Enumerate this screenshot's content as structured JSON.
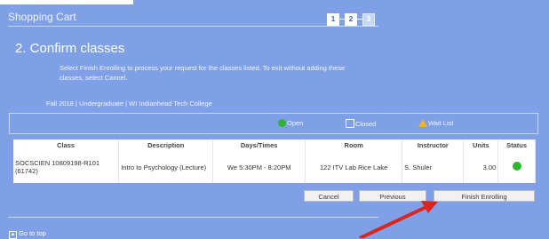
{
  "header": {
    "cart_title": "Shopping Cart",
    "steps": [
      "1",
      "2",
      "3"
    ],
    "active_steps": [
      1,
      2
    ]
  },
  "section": {
    "title": "2.  Confirm classes",
    "instructions": "Select Finish Enrolling to process your request for the classes listed. To exit without adding these classes, select Cancel.",
    "term": "Fall 2018 | Undergraduate | WI Indianhead Tech College"
  },
  "legend": {
    "open": "Open",
    "closed": "Closed",
    "wait_list": "Wait List"
  },
  "table": {
    "headers": [
      "Class",
      "Description",
      "Days/Times",
      "Room",
      "Instructor",
      "Units",
      "Status"
    ],
    "rows": [
      {
        "class": "SOCSCIEN 10809198-R101 (61742)",
        "description": "Intro to Psychology (Lecture)",
        "days_times": "We 5:30PM - 8:20PM",
        "room": "122 ITV Lab Rice Lake",
        "instructor": "S. Shuler",
        "units": "3.00",
        "status": "Open"
      }
    ]
  },
  "buttons": {
    "cancel": "Cancel",
    "previous": "Previous",
    "finish": "Finish Enrolling"
  },
  "footer": {
    "go_to_top": "Go to top"
  },
  "colors": {
    "background": "#7fa0e6",
    "open_status": "#2fb52f",
    "wait_list": "#f2b51c",
    "annotation_arrow": "#d9261c"
  }
}
